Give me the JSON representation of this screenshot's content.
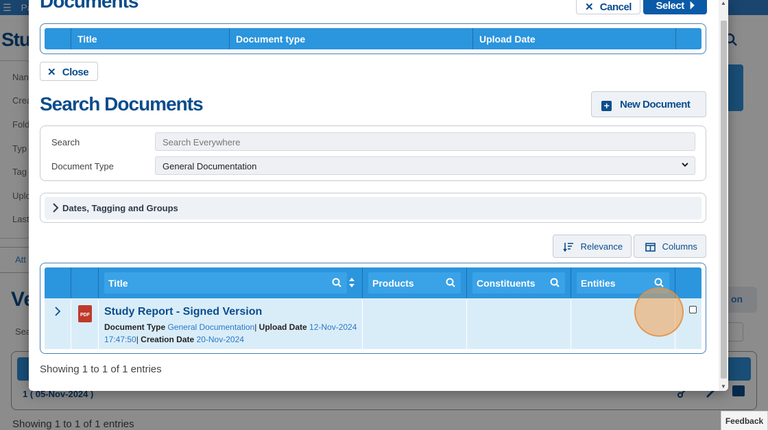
{
  "background": {
    "topbar_text": "Pa",
    "page_title": "Stu",
    "card_labels": [
      "Nan",
      "Crea",
      "Fold",
      "Typ",
      "Tag",
      "Uplo",
      "Last"
    ],
    "tab_label": "Att",
    "section_title": "Ve",
    "search_label": "Sea",
    "row_text": "1 ( 05-Nov-2024 )",
    "showing": "Showing 1 to 1 of 1 entries",
    "right_button_text": "on",
    "feedback": "Feedback"
  },
  "modal": {
    "title": "Documents",
    "cancel_label": "Cancel",
    "select_label": "Select",
    "selected_table": {
      "columns": [
        "Title",
        "Document type",
        "Upload Date"
      ]
    },
    "close_label": "Close",
    "search_title": "Search Documents",
    "new_document_label": "New Document",
    "filters": {
      "search_label": "Search",
      "search_placeholder": "Search Everywhere",
      "doc_type_label": "Document Type",
      "doc_type_value": "General Documentation"
    },
    "dates_section_label": "Dates, Tagging and Groups",
    "relevance_label": "Relevance",
    "columns_label": "Columns",
    "results": {
      "columns": [
        "Title",
        "Products",
        "Constituents",
        "Entities"
      ],
      "rows": [
        {
          "file_type": "PDF",
          "title": "Study Report - Signed Version",
          "doc_type_label": "Document Type",
          "doc_type_value": "General Documentation",
          "upload_label": "Upload Date",
          "upload_value": "12-Nov-2024 17:47:50",
          "creation_label": "Creation Date",
          "creation_value": "20-Nov-2024"
        }
      ]
    },
    "showing": "Showing 1 to 1 of 1 entries"
  },
  "colors": {
    "primary": "#0b4d8c",
    "header_blue": "#2b95dd",
    "row_highlight": "#d9edf9",
    "pdf_red": "#c0392b",
    "click_marker": "#f0a050"
  }
}
